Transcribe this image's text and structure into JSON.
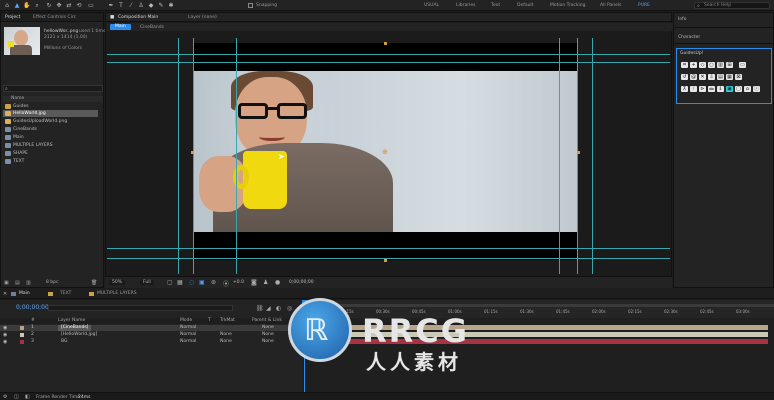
{
  "toolbar": {
    "tools": [
      "home-icon",
      "selection-icon",
      "hand-icon",
      "zoom-icon",
      "orbit-icon",
      "pan-icon",
      "dolly-icon",
      "rotate-icon",
      "rect-icon",
      "pen-icon",
      "type-icon",
      "brush-icon",
      "stamp-icon",
      "eraser-icon",
      "roto-icon",
      "puppet-icon"
    ],
    "snapping_label": "Snapping",
    "workspaces": [
      "USUAL",
      "Libraries",
      "Text",
      "Default",
      "Motion Tracking",
      "All Panels",
      "PURE"
    ],
    "search_placeholder": "Search Help"
  },
  "project": {
    "tabs": [
      "Project",
      "Effect Controls Circ"
    ],
    "preview_name": "hellowWor..png",
    "preview_used": "used 1 time",
    "preview_size": "2121 x 1414 (1.00)",
    "preview_colors": "Millions of Colors",
    "search_placeholder": "",
    "column_header": "Name",
    "items": [
      {
        "name": "Guides",
        "type": "folder"
      },
      {
        "name": "HelloWorld.jpg",
        "type": "image"
      },
      {
        "name": "GuidesUploadWorld.png",
        "type": "image"
      },
      {
        "name": "CineBands",
        "type": "comp"
      },
      {
        "name": "Main",
        "type": "comp"
      },
      {
        "name": "MULTIPLE LAYERS",
        "type": "comp"
      },
      {
        "name": "SHAPE",
        "type": "comp"
      },
      {
        "name": "TEXT",
        "type": "comp"
      }
    ],
    "bpc": "8 bpc"
  },
  "composition": {
    "tab_label": "Composition Main",
    "layer_tab": "Layer (none)",
    "subtabs": [
      "Main",
      "CineBands"
    ],
    "zoom": "50%",
    "resolution": "Full",
    "exposure": "+0.0",
    "timecode": "0;00;00;00"
  },
  "right_panels": {
    "info_label": "Info",
    "character_label": "Character",
    "guides_label": "GuidesUp!"
  },
  "timeline": {
    "tabs": [
      "Main",
      "TEXT",
      "MULTIPLE LAYERS"
    ],
    "timecode": "0;00;00;00",
    "columns": [
      "#",
      "Layer Name",
      "Mode",
      "T",
      "TrkMat",
      "Parent & Link"
    ],
    "layers": [
      {
        "num": "1",
        "name": "[CineBands]",
        "mode": "Normal",
        "trkmat": "",
        "parent": "None",
        "color": "#b6a58a"
      },
      {
        "num": "2",
        "name": "[HelloWorld.jpg]",
        "mode": "Normal",
        "trkmat": "None",
        "parent": "None",
        "color": "#c9c9b4"
      },
      {
        "num": "3",
        "name": "BG",
        "mode": "Normal",
        "trkmat": "None",
        "parent": "None",
        "color": "#a83244"
      }
    ],
    "ruler_ticks": [
      "00s",
      "00:15s",
      "00:30s",
      "00:45s",
      "01:00s",
      "01:15s",
      "01:30s",
      "01:45s",
      "02:00s",
      "02:15s",
      "02:30s",
      "02:45s",
      "03:00s"
    ],
    "status": "Frame Render Time",
    "render_time": "24ms"
  },
  "watermark": {
    "brand": "RRCG",
    "subtitle": "人人素材"
  },
  "colors": {
    "guide": "#3aa6ad",
    "playhead": "#2d8ceb",
    "accent": "#2d8ceb"
  }
}
